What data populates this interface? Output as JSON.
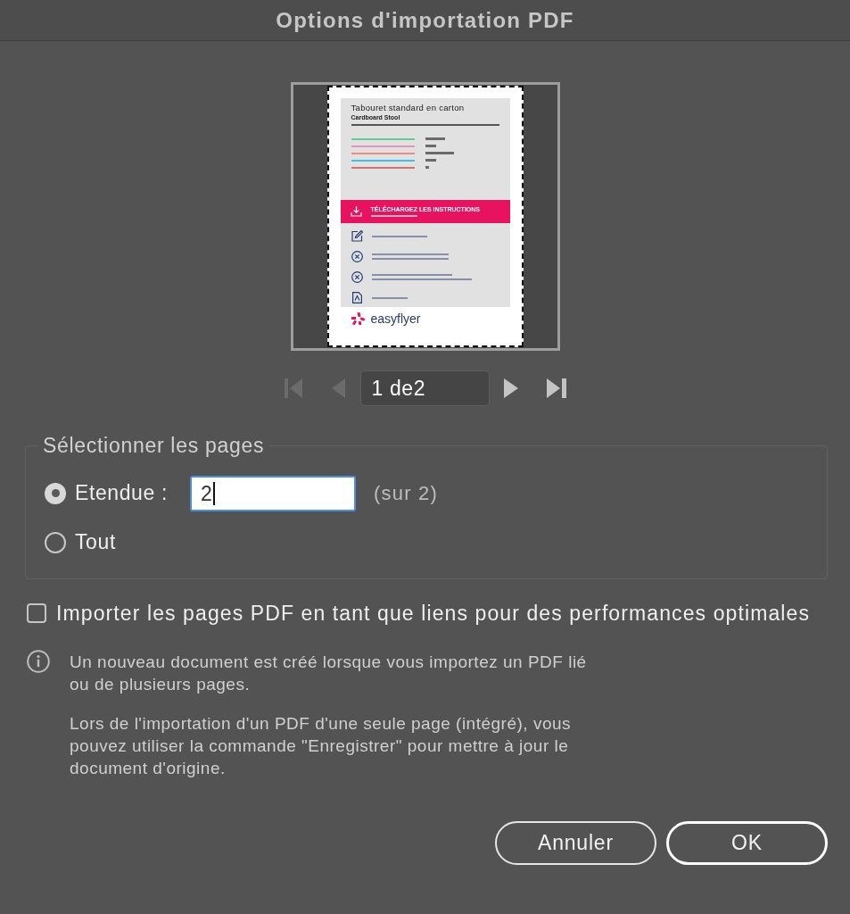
{
  "window": {
    "title": "Options d'importation PDF"
  },
  "preview": {
    "title": "Tabouret standard en carton",
    "subtitle": "Cardboard Stool",
    "legend": [
      {
        "color": "#5ccf97"
      },
      {
        "color": "#e891c4"
      },
      {
        "color": "#ee8a83"
      },
      {
        "color": "#40c0ee"
      },
      {
        "color": "#d9716b"
      }
    ],
    "banner": "TÉLÉCHARGEZ LES INSTRUCTIONS",
    "steps": [
      {
        "kind": "edit"
      },
      {
        "kind": "cross"
      },
      {
        "kind": "cross"
      },
      {
        "kind": "file"
      }
    ],
    "logo": "easyflyer"
  },
  "pager": {
    "controls": [
      {
        "kind": "first",
        "disabled": true
      },
      {
        "kind": "previous",
        "disabled": true
      },
      {
        "kind": "field",
        "value": "1 de2"
      },
      {
        "kind": "next",
        "disabled": false
      },
      {
        "kind": "last",
        "disabled": false
      }
    ]
  },
  "page_selection": {
    "legend": "Sélectionner les pages",
    "options": [
      {
        "label": "Etendue :",
        "selected": true,
        "field": {
          "value": "2",
          "focused": true
        },
        "note": "(sur 2)"
      },
      {
        "label": "Tout",
        "selected": false
      }
    ]
  },
  "link_option": {
    "label": "Importer les pages PDF en tant que liens pour des performances optimales",
    "checked": false
  },
  "info": {
    "paragraphs": [
      "Un nouveau document est créé lorsque vous importez un PDF lié ou de plusieurs pages.",
      "Lors de l'importation d'un PDF d'une seule page (intégré), vous pouvez utiliser la commande \"Enregistrer\" pour mettre à jour le document d'origine."
    ]
  },
  "buttons": [
    {
      "label": "Annuler",
      "default": false
    },
    {
      "label": "OK",
      "default": true
    }
  ]
}
